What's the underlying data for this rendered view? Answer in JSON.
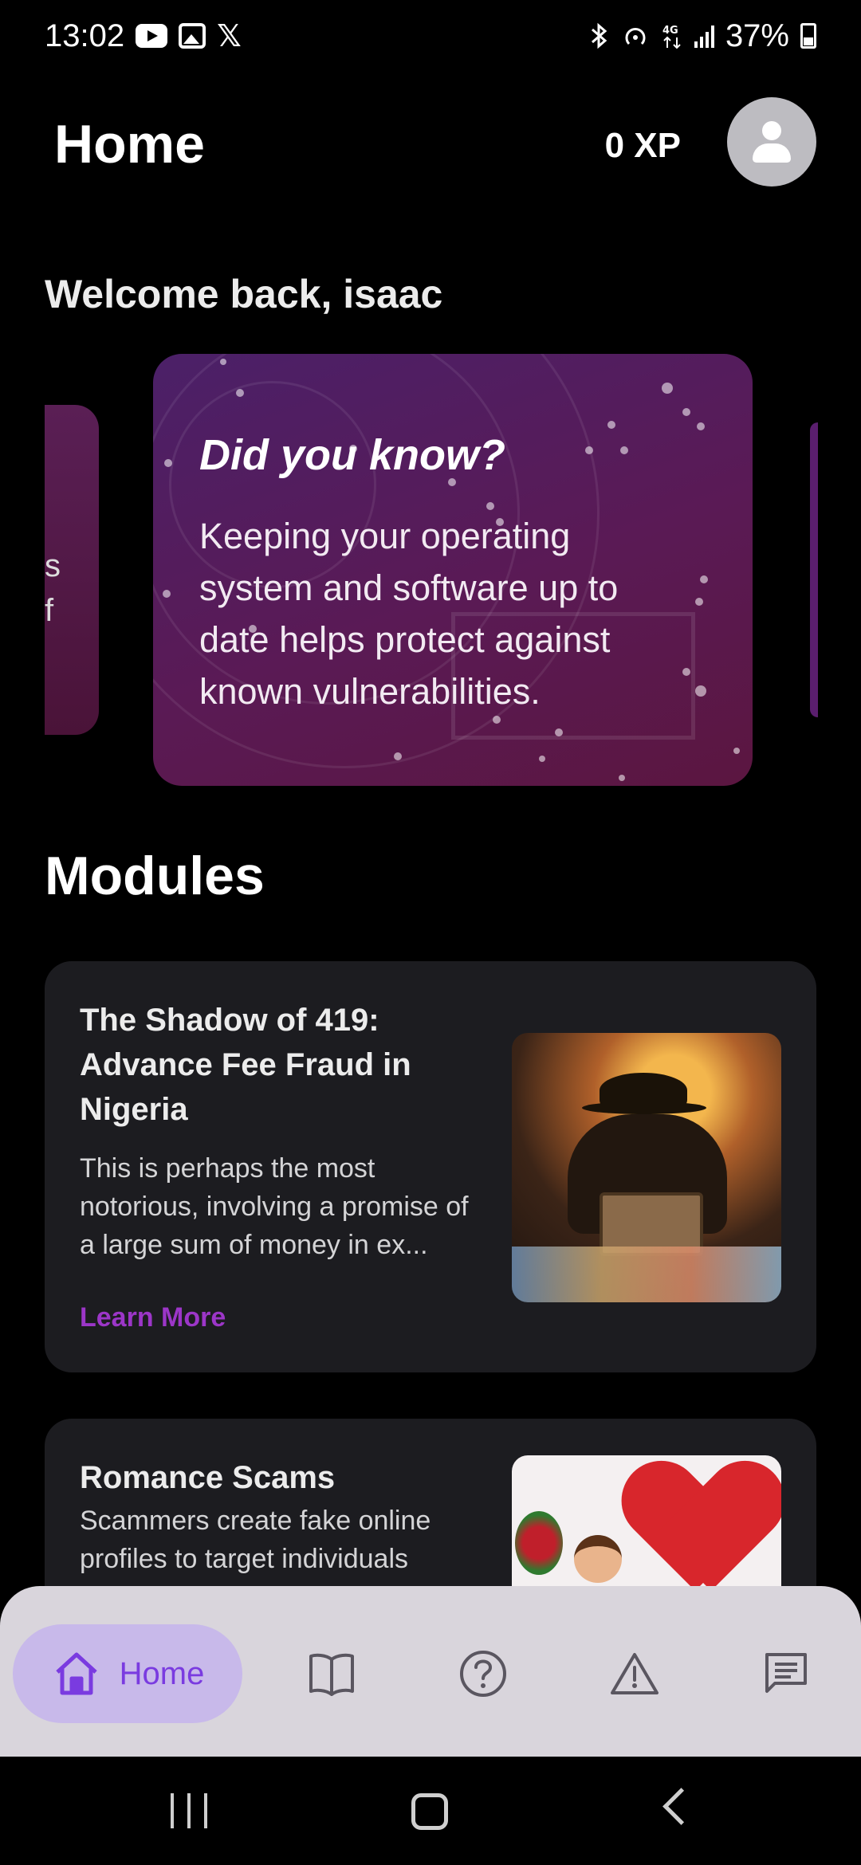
{
  "status_bar": {
    "time": "13:02",
    "battery": "37%",
    "network": "4G",
    "notification_icons": [
      "youtube-icon",
      "gallery-icon",
      "x-icon"
    ],
    "system_icons": [
      "bluetooth-icon",
      "hotspot-icon",
      "network-4g-icon",
      "signal-icon",
      "battery-icon"
    ]
  },
  "header": {
    "title": "Home",
    "xp": "0 XP"
  },
  "welcome": "Welcome back, isaac",
  "tip_card": {
    "heading": "Did you know?",
    "body": "Keeping your operating system and software up to date helps protect against known vulnerabilities."
  },
  "side_card_left": {
    "partial_text": [
      "s",
      "f"
    ]
  },
  "modules_section": {
    "title": "Modules",
    "items": [
      {
        "title": "The Shadow of 419: Advance Fee Fraud in Nigeria",
        "description": "This is perhaps the most notorious, involving a promise of a large sum of money in ex...",
        "link": "Learn More"
      },
      {
        "title": "Romance Scams",
        "description": "Scammers create fake online profiles to target individuals"
      }
    ]
  },
  "bottom_nav": {
    "items": [
      {
        "label": "Home",
        "icon": "home-icon",
        "active": true
      },
      {
        "icon": "book-icon"
      },
      {
        "icon": "help-icon"
      },
      {
        "icon": "warning-icon"
      },
      {
        "icon": "chat-icon"
      }
    ],
    "active_color": "#7a3be0"
  },
  "colors": {
    "accent": "#9c36c8",
    "card_bg": "#1c1c20",
    "background": "#000000"
  }
}
